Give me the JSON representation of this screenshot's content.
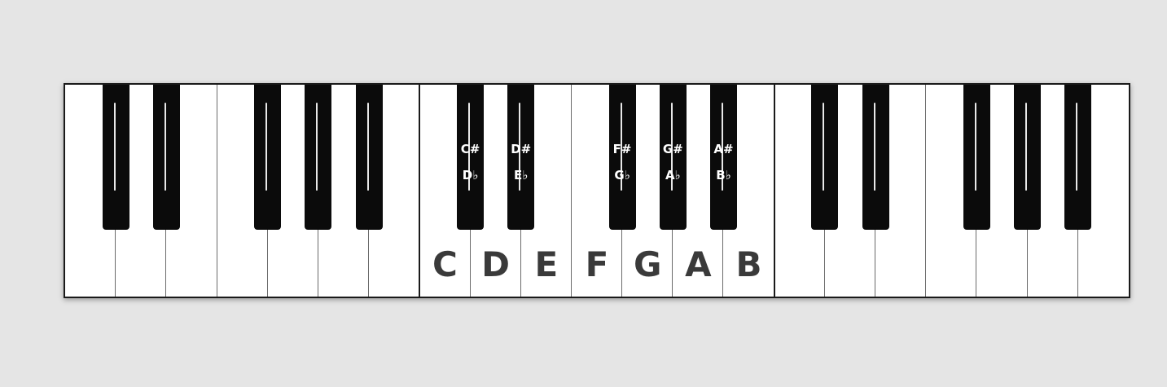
{
  "keyboard": {
    "octaves": 3,
    "labeled_octave": 1,
    "white_key_labels": [
      "C",
      "D",
      "E",
      "F",
      "G",
      "A",
      "B"
    ],
    "sharp_labels": [
      "C#",
      "D#",
      "F#",
      "G#",
      "A#"
    ],
    "flat_labels": [
      "D♭",
      "E♭",
      "G♭",
      "A♭",
      "B♭"
    ]
  },
  "colors": {
    "background": "#e5e5e5",
    "white_key": "#ffffff",
    "black_key": "#0b0b0b",
    "label_dark": "#3a3a3a",
    "label_light": "#ffffff"
  }
}
